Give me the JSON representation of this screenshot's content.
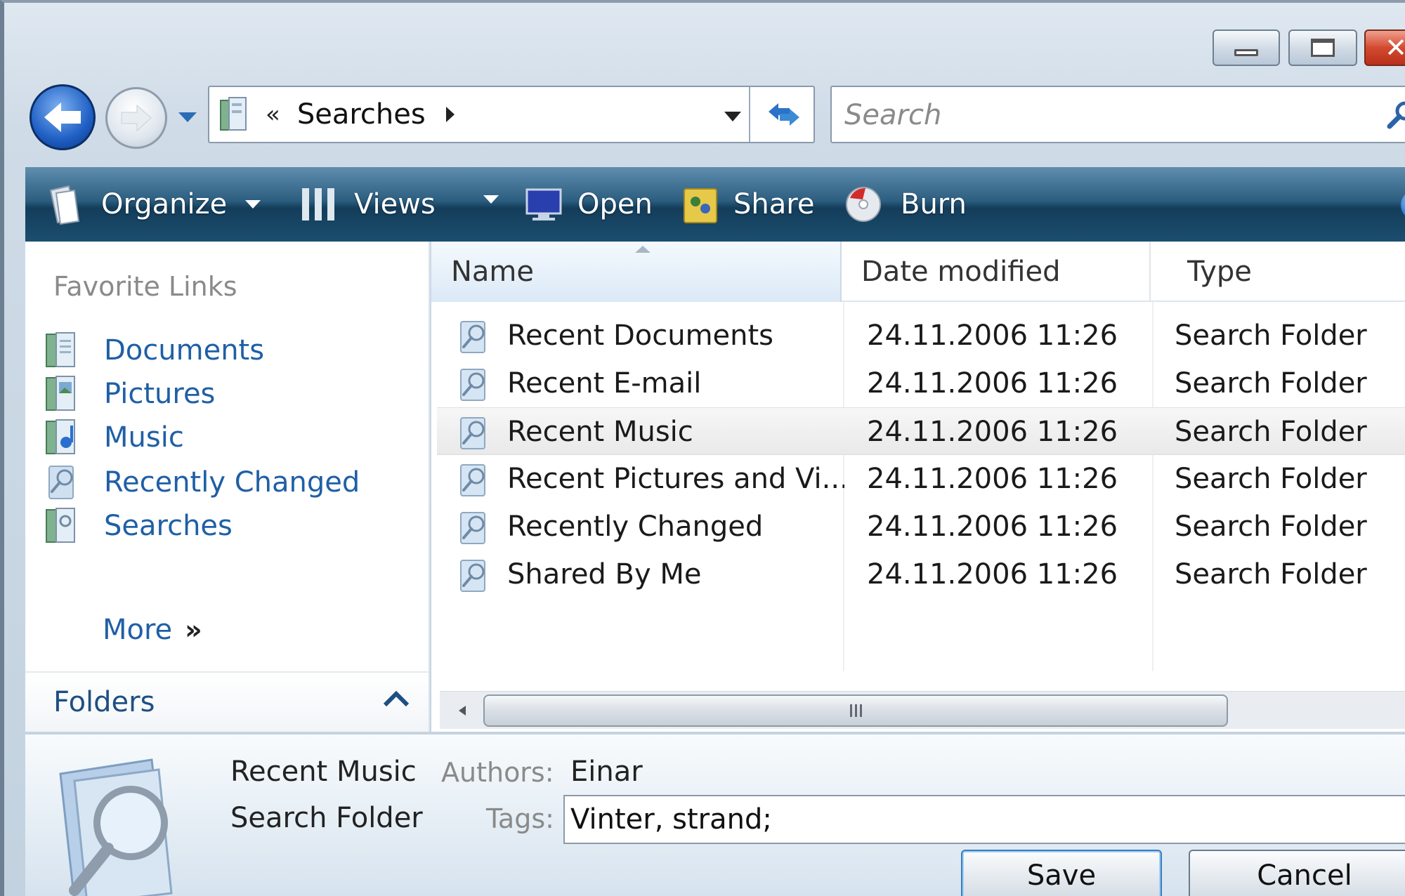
{
  "address": {
    "chevrons": "«",
    "crumb": "Searches"
  },
  "search": {
    "placeholder": "Search"
  },
  "toolbar": {
    "organize": "Organize",
    "views": "Views",
    "open": "Open",
    "share": "Share",
    "burn": "Burn",
    "help": "?"
  },
  "nav": {
    "favorites_title": "Favorite Links",
    "links": [
      {
        "label": "Documents",
        "icon": "documents-icon"
      },
      {
        "label": "Pictures",
        "icon": "pictures-icon"
      },
      {
        "label": "Music",
        "icon": "music-icon"
      },
      {
        "label": "Recently Changed",
        "icon": "search-folder-icon"
      },
      {
        "label": "Searches",
        "icon": "searches-icon"
      }
    ],
    "more": "More",
    "more_glyph": "»",
    "folders": "Folders"
  },
  "list": {
    "columns": {
      "name": "Name",
      "date": "Date modified",
      "type": "Type"
    },
    "rows": [
      {
        "name": "Recent Documents",
        "date": "24.11.2006 11:26",
        "type": "Search Folder"
      },
      {
        "name": "Recent E-mail",
        "date": "24.11.2006 11:26",
        "type": "Search Folder"
      },
      {
        "name": "Recent Music",
        "date": "24.11.2006 11:26",
        "type": "Search Folder"
      },
      {
        "name": "Recent Pictures and Vi...",
        "date": "24.11.2006 11:26",
        "type": "Search Folder"
      },
      {
        "name": "Recently Changed",
        "date": "24.11.2006 11:26",
        "type": "Search Folder"
      },
      {
        "name": "Shared By Me",
        "date": "24.11.2006 11:26",
        "type": "Search Folder"
      }
    ],
    "selected_index": 2
  },
  "details": {
    "name": "Recent Music",
    "type": "Search Folder",
    "authors_label": "Authors:",
    "authors_value": "Einar",
    "tags_label": "Tags:",
    "tags_value": "Vinter, strand;"
  },
  "buttons": {
    "save": "Save",
    "cancel": "Cancel"
  }
}
